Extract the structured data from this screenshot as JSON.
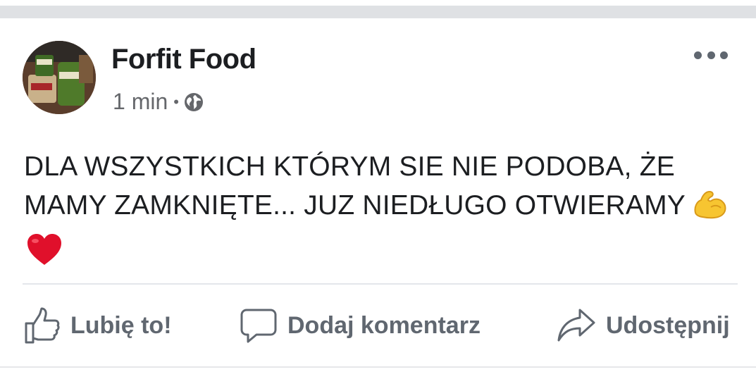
{
  "post": {
    "author": "Forfit Food",
    "timestamp": "1 min",
    "separator": "•",
    "privacy_icon": "globe-icon",
    "text": "DLA WSZYSTKICH KTÓRYM SIE NIE PODOBA, ŻE MAMY ZAMKNIĘTE... JUZ NIEDŁUGO OTWIERAMY",
    "emojis": [
      "flexed-biceps",
      "red-heart"
    ]
  },
  "actions": {
    "like_label": "Lubię to!",
    "comment_label": "Dodaj komentarz",
    "share_label": "Udostępnij"
  },
  "colors": {
    "text_primary": "#1c1e21",
    "text_secondary": "#65676b",
    "action_gray": "#606770",
    "heart_red": "#e0102b",
    "biceps_yellow": "#f7c531"
  }
}
